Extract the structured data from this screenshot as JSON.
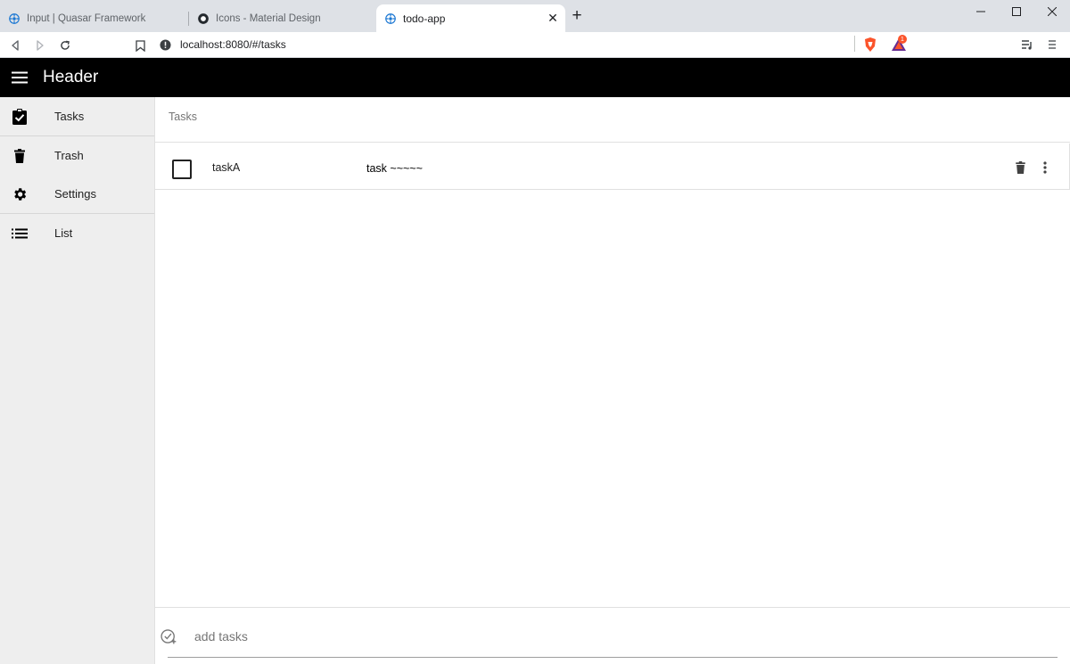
{
  "browser": {
    "tabs": [
      {
        "title": "Input | Quasar Framework",
        "icon": "quasar-icon"
      },
      {
        "title": "Icons - Material Design",
        "icon": "github-icon"
      },
      {
        "title": "todo-app",
        "icon": "quasar-icon",
        "active": true
      }
    ],
    "url": "localhost:8080/#/tasks",
    "notification_badge": "1"
  },
  "header": {
    "title": "Header"
  },
  "drawer": {
    "items": [
      {
        "label": "Tasks",
        "icon": "clipboard-check-icon"
      },
      {
        "label": "Trash",
        "icon": "trash-icon"
      },
      {
        "label": "Settings",
        "icon": "gear-icon"
      },
      {
        "label": "List",
        "icon": "list-icon"
      }
    ]
  },
  "main": {
    "title": "Tasks",
    "tasks": [
      {
        "name": "taskA",
        "description": "task ~~~~~",
        "done": false
      }
    ],
    "add": {
      "placeholder": "add tasks"
    }
  },
  "colors": {
    "header_bg": "#000000",
    "drawer_bg": "#eeeeee",
    "quasar_blue": "#1976d2"
  }
}
